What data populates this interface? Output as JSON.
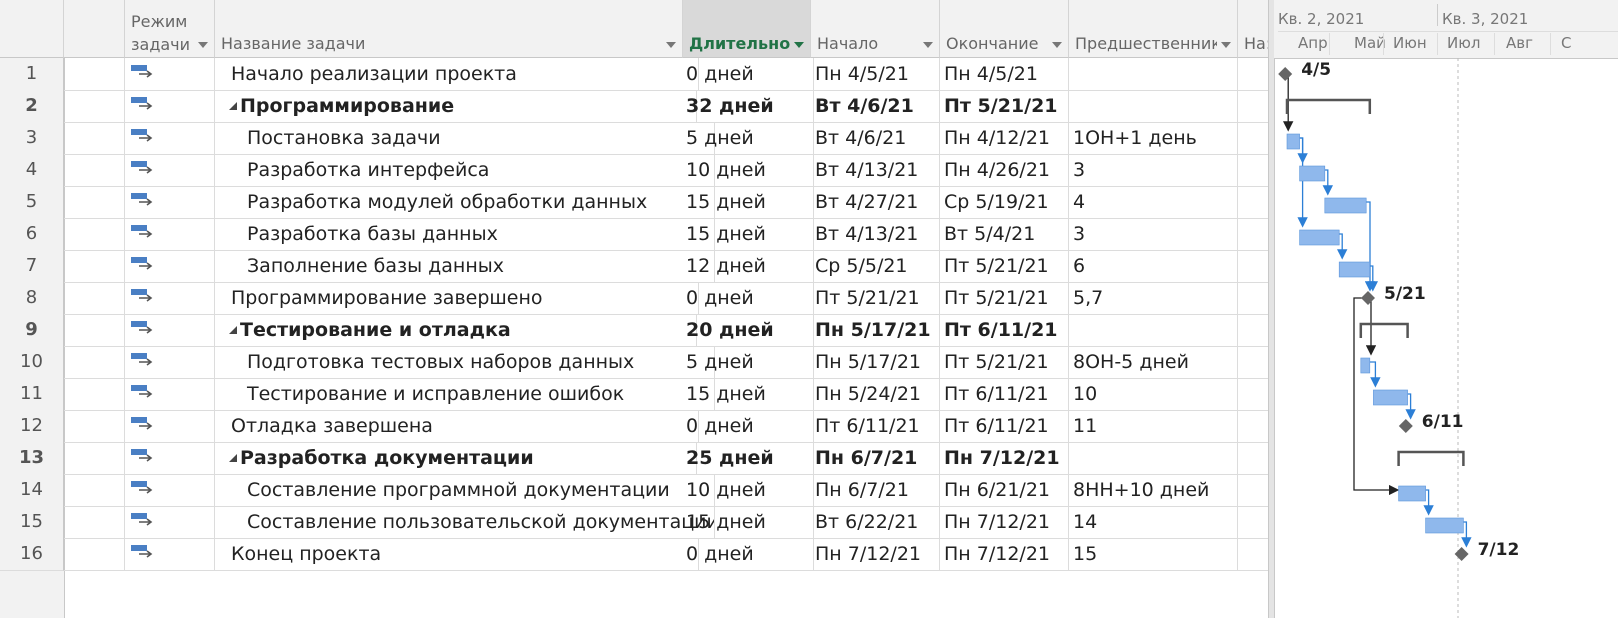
{
  "columns": {
    "info_tooltip": "i",
    "mode_line1": "Режим",
    "mode_line2": "задачи",
    "name": "Название задачи",
    "duration": "Длительнос",
    "start": "Начало",
    "finish": "Окончание",
    "predecessors": "Предшественник",
    "extra": "На:"
  },
  "tasks": [
    {
      "id": "1",
      "name": "Начало реализации проекта",
      "duration": "0 дней",
      "start": "Пн 4/5/21",
      "finish": "Пн 4/5/21",
      "pred": "",
      "level": 1,
      "summary": false
    },
    {
      "id": "2",
      "name": "Программирование",
      "duration": "32 дней",
      "start": "Вт 4/6/21",
      "finish": "Пт 5/21/21",
      "pred": "",
      "level": 1,
      "summary": true
    },
    {
      "id": "3",
      "name": "Постановка задачи",
      "duration": "5 дней",
      "start": "Вт 4/6/21",
      "finish": "Пн 4/12/21",
      "pred": "1ОН+1 день",
      "level": 2,
      "summary": false
    },
    {
      "id": "4",
      "name": "Разработка интерфейса",
      "duration": "10 дней",
      "start": "Вт 4/13/21",
      "finish": "Пн 4/26/21",
      "pred": "3",
      "level": 2,
      "summary": false
    },
    {
      "id": "5",
      "name": "Разработка модулей обработки данных",
      "duration": "15 дней",
      "start": "Вт 4/27/21",
      "finish": "Ср 5/19/21",
      "pred": "4",
      "level": 2,
      "summary": false
    },
    {
      "id": "6",
      "name": "Разработка базы данных",
      "duration": "15 дней",
      "start": "Вт 4/13/21",
      "finish": "Вт 5/4/21",
      "pred": "3",
      "level": 2,
      "summary": false
    },
    {
      "id": "7",
      "name": "Заполнение базы данных",
      "duration": "12 дней",
      "start": "Ср 5/5/21",
      "finish": "Пт 5/21/21",
      "pred": "6",
      "level": 2,
      "summary": false
    },
    {
      "id": "8",
      "name": "Программирование завершено",
      "duration": "0 дней",
      "start": "Пт 5/21/21",
      "finish": "Пт 5/21/21",
      "pred": "5,7",
      "level": 1,
      "summary": false
    },
    {
      "id": "9",
      "name": "Тестирование и отладка",
      "duration": "20 дней",
      "start": "Пн 5/17/21",
      "finish": "Пт 6/11/21",
      "pred": "",
      "level": 1,
      "summary": true
    },
    {
      "id": "10",
      "name": "Подготовка тестовых наборов данных",
      "duration": "5 дней",
      "start": "Пн 5/17/21",
      "finish": "Пт 5/21/21",
      "pred": "8ОН-5 дней",
      "level": 2,
      "summary": false
    },
    {
      "id": "11",
      "name": "Тестирование и исправление ошибок",
      "duration": "15 дней",
      "start": "Пн 5/24/21",
      "finish": "Пт 6/11/21",
      "pred": "10",
      "level": 2,
      "summary": false
    },
    {
      "id": "12",
      "name": "Отладка завершена",
      "duration": "0 дней",
      "start": "Пт 6/11/21",
      "finish": "Пт 6/11/21",
      "pred": "11",
      "level": 1,
      "summary": false
    },
    {
      "id": "13",
      "name": "Разработка документации",
      "duration": "25 дней",
      "start": "Пн 6/7/21",
      "finish": "Пн 7/12/21",
      "pred": "",
      "level": 1,
      "summary": true
    },
    {
      "id": "14",
      "name": "Составление программной документации",
      "duration": "10 дней",
      "start": "Пн 6/7/21",
      "finish": "Пн 6/21/21",
      "pred": "8НН+10 дней",
      "level": 2,
      "summary": false
    },
    {
      "id": "15",
      "name": "Составление пользовательской документации",
      "duration": "15 дней",
      "start": "Вт 6/22/21",
      "finish": "Пн 7/12/21",
      "pred": "14",
      "level": 2,
      "summary": false
    },
    {
      "id": "16",
      "name": "Конец проекта",
      "duration": "0 дней",
      "start": "Пн 7/12/21",
      "finish": "Пн 7/12/21",
      "pred": "15",
      "level": 1,
      "summary": false
    }
  ],
  "timescale": {
    "quarters": [
      "Кв. 2, 2021",
      "Кв. 3, 2021"
    ],
    "months": [
      "Апр",
      "Май",
      "Июн",
      "Июл",
      "Авг",
      "С"
    ]
  },
  "milestone_labels": [
    "4/5",
    "5/21",
    "6/11",
    "7/12"
  ],
  "colors": {
    "bar": "#8fb8ec",
    "bar_border": "#5b95db",
    "link": "#2c7fd6",
    "milestone": "#666666",
    "summary": "#555555",
    "active_header_text": "#217346"
  }
}
